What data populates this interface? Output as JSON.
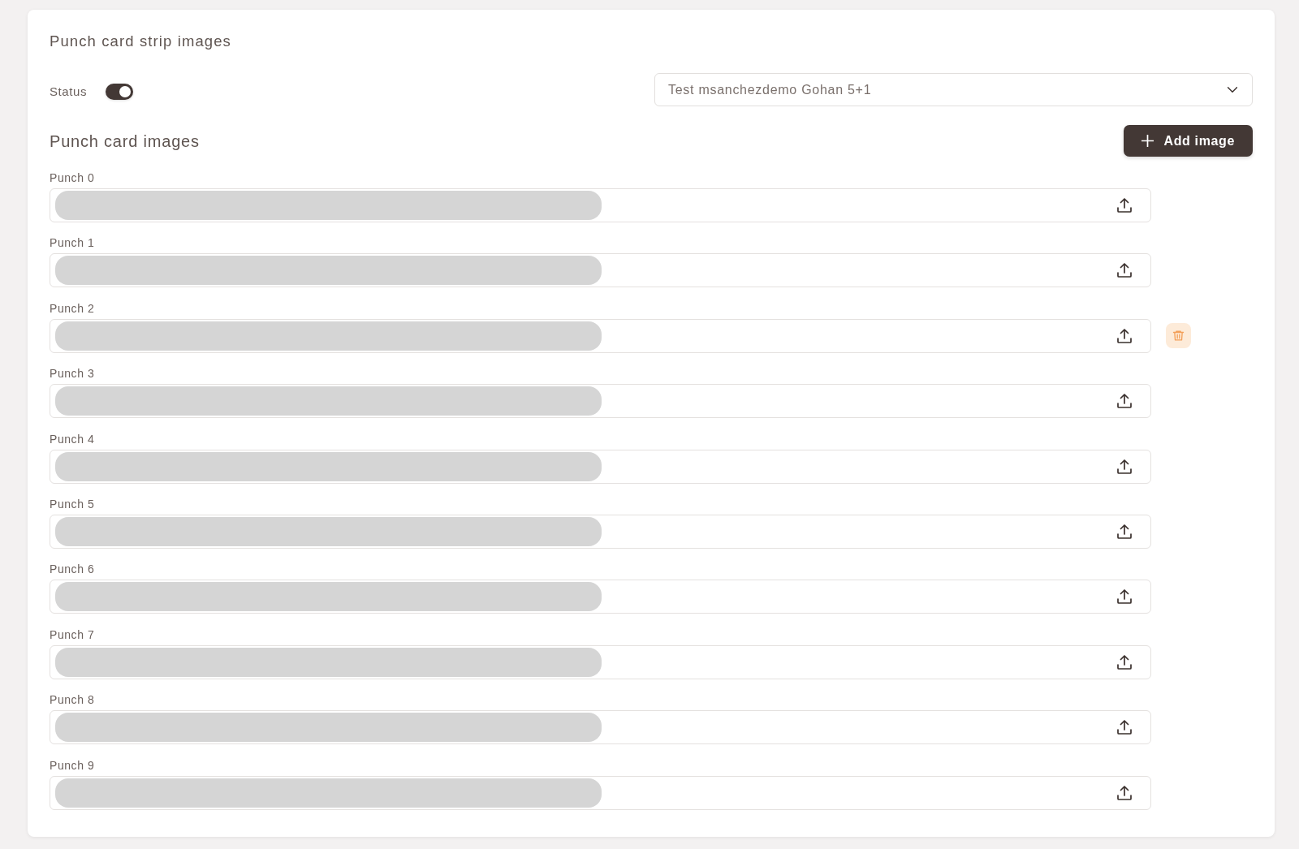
{
  "title": "Punch card strip images",
  "status": {
    "label": "Status",
    "on": true
  },
  "select": {
    "value": "Test msanchezdemo Gohan 5+1"
  },
  "images_section": {
    "title": "Punch card images",
    "add_button": "Add image"
  },
  "punches": [
    {
      "label": "Punch 0",
      "delete_visible": false
    },
    {
      "label": "Punch 1",
      "delete_visible": false
    },
    {
      "label": "Punch 2",
      "delete_visible": true
    },
    {
      "label": "Punch 3",
      "delete_visible": false
    },
    {
      "label": "Punch 4",
      "delete_visible": false
    },
    {
      "label": "Punch 5",
      "delete_visible": false
    },
    {
      "label": "Punch 6",
      "delete_visible": false
    },
    {
      "label": "Punch 7",
      "delete_visible": false
    },
    {
      "label": "Punch 8",
      "delete_visible": false
    },
    {
      "label": "Punch 9",
      "delete_visible": false
    }
  ]
}
